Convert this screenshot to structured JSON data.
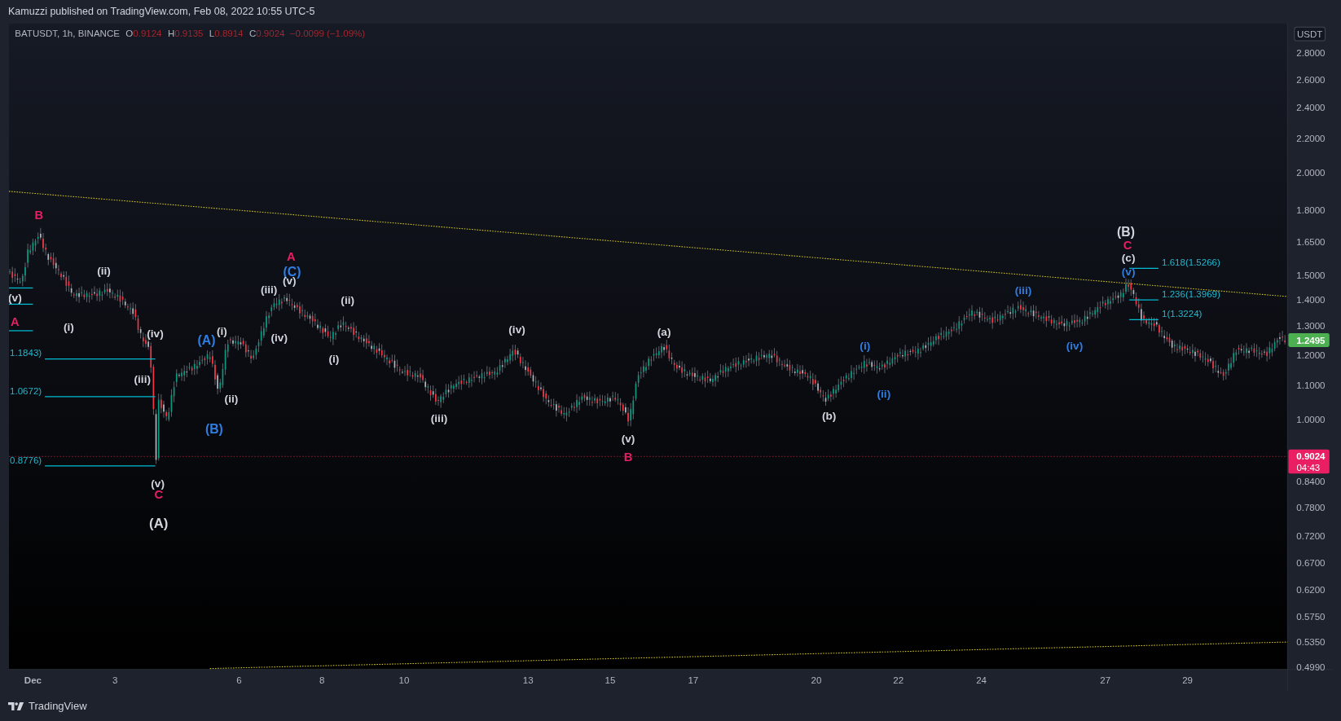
{
  "header": {
    "text": "Kamuzzi published on TradingView.com, Feb 08, 2022 10:55 UTC-5"
  },
  "legend": {
    "symbol": "BATUSDT, 1h, BINANCE",
    "fields": [
      {
        "key": "O",
        "value": "0.9124"
      },
      {
        "key": "H",
        "value": "0.9135"
      },
      {
        "key": "L",
        "value": "0.8914"
      },
      {
        "key": "C",
        "value": "0.9024"
      }
    ],
    "change": "−0.0099 (−1.09%)"
  },
  "price_axis": {
    "currency": "USDT",
    "labels": [
      "2.8000",
      "2.6000",
      "2.4000",
      "2.2000",
      "2.0000",
      "1.8000",
      "1.6500",
      "1.5000",
      "1.4000",
      "1.3000",
      "1.2000",
      "1.1000",
      "1.0000",
      "0.8400",
      "0.7800",
      "0.7200",
      "0.6700",
      "0.6200",
      "0.5750",
      "0.5350",
      "0.4990"
    ],
    "last_price": "1.2495",
    "current_price": "0.9024",
    "countdown": "04:43"
  },
  "time_axis": {
    "labels": [
      "Dec",
      "3",
      "6",
      "8",
      "10",
      "13",
      "15",
      "17",
      "20",
      "22",
      "24",
      "27",
      "29"
    ]
  },
  "wave_labels": [
    {
      "text": "B",
      "color": "#e91e63"
    },
    {
      "text": "(v)",
      "color": "#d1d4dc"
    },
    {
      "text": "A",
      "color": "#e91e63"
    },
    {
      "text": "(ii)",
      "color": "#d1d4dc"
    },
    {
      "text": "(i)",
      "color": "#d1d4dc"
    },
    {
      "text": "(iv)",
      "color": "#d1d4dc"
    },
    {
      "text": "(iii)",
      "color": "#d1d4dc"
    },
    {
      "text": "(v)",
      "color": "#d1d4dc"
    },
    {
      "text": "C",
      "color": "#e91e63"
    },
    {
      "text": "(A)",
      "color": "#d1d4dc"
    },
    {
      "text": "(A)",
      "color": "#2f7de1"
    },
    {
      "text": "(i)",
      "color": "#d1d4dc"
    },
    {
      "text": "(ii)",
      "color": "#d1d4dc"
    },
    {
      "text": "(B)",
      "color": "#2f7de1"
    },
    {
      "text": "(iii)",
      "color": "#d1d4dc"
    },
    {
      "text": "(iv)",
      "color": "#d1d4dc"
    },
    {
      "text": "A",
      "color": "#e91e63"
    },
    {
      "text": "(C)",
      "color": "#2f7de1"
    },
    {
      "text": "(v)",
      "color": "#d1d4dc"
    },
    {
      "text": "(ii)",
      "color": "#d1d4dc"
    },
    {
      "text": "(i)",
      "color": "#d1d4dc"
    },
    {
      "text": "(iv)",
      "color": "#d1d4dc"
    },
    {
      "text": "(iii)",
      "color": "#d1d4dc"
    },
    {
      "text": "(a)",
      "color": "#d1d4dc"
    },
    {
      "text": "(v)",
      "color": "#d1d4dc"
    },
    {
      "text": "B",
      "color": "#e91e63"
    },
    {
      "text": "(b)",
      "color": "#d1d4dc"
    },
    {
      "text": "(i)",
      "color": "#2f7de1"
    },
    {
      "text": "(ii)",
      "color": "#2f7de1"
    },
    {
      "text": "(iii)",
      "color": "#2f7de1"
    },
    {
      "text": "(iv)",
      "color": "#2f7de1"
    },
    {
      "text": "(B)",
      "color": "#d1d4dc"
    },
    {
      "text": "C",
      "color": "#e91e63"
    },
    {
      "text": "(c)",
      "color": "#d1d4dc"
    },
    {
      "text": "(v)",
      "color": "#2f7de1"
    }
  ],
  "fib_labels": [
    "1.1843)",
    "1.0672)",
    "0.8776)",
    "1.618(1.5266)",
    "1.236(1.3969)",
    "1(1.3224)"
  ],
  "footer": {
    "brand": "TradingView"
  }
}
